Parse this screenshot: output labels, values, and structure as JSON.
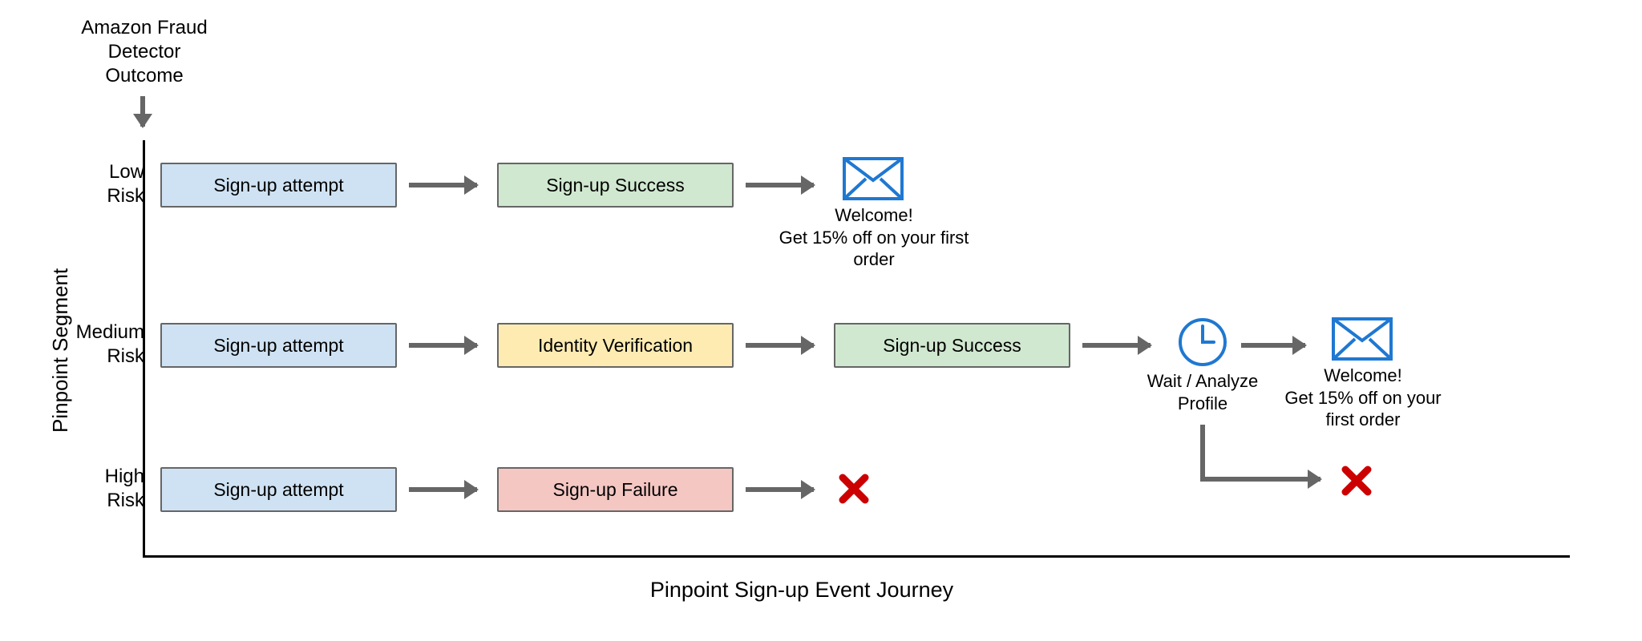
{
  "header": "Amazon Fraud\nDetector\nOutcome",
  "yAxisLabel": "Pinpoint  Segment",
  "xAxisLabel": "Pinpoint Sign-up Event Journey",
  "segments": {
    "low": "Low\nRisk",
    "medium": "Medium\nRisk",
    "high": "High\nRisk"
  },
  "boxes": {
    "signup_attempt": "Sign-up attempt",
    "signup_success": "Sign-up Success",
    "identity_verification": "Identity Verification",
    "signup_failure": "Sign-up Failure"
  },
  "messages": {
    "welcome": "Welcome!\nGet 15% off on your first\norder",
    "welcome2": "Welcome!\nGet 15% off on your\nfirst order",
    "wait_profile": "Wait / Analyze\nProfile"
  },
  "icons": {
    "mail": "mail-icon",
    "clock": "clock-icon",
    "x": "x-icon"
  },
  "colors": {
    "flow_blue": "#cfe2f3",
    "flow_green": "#d0e8cf",
    "flow_yellow": "#fdebb2",
    "flow_red": "#f4c7c3",
    "icon_blue": "#1f78d1",
    "icon_red": "#cc0000",
    "arrow": "#666666"
  }
}
